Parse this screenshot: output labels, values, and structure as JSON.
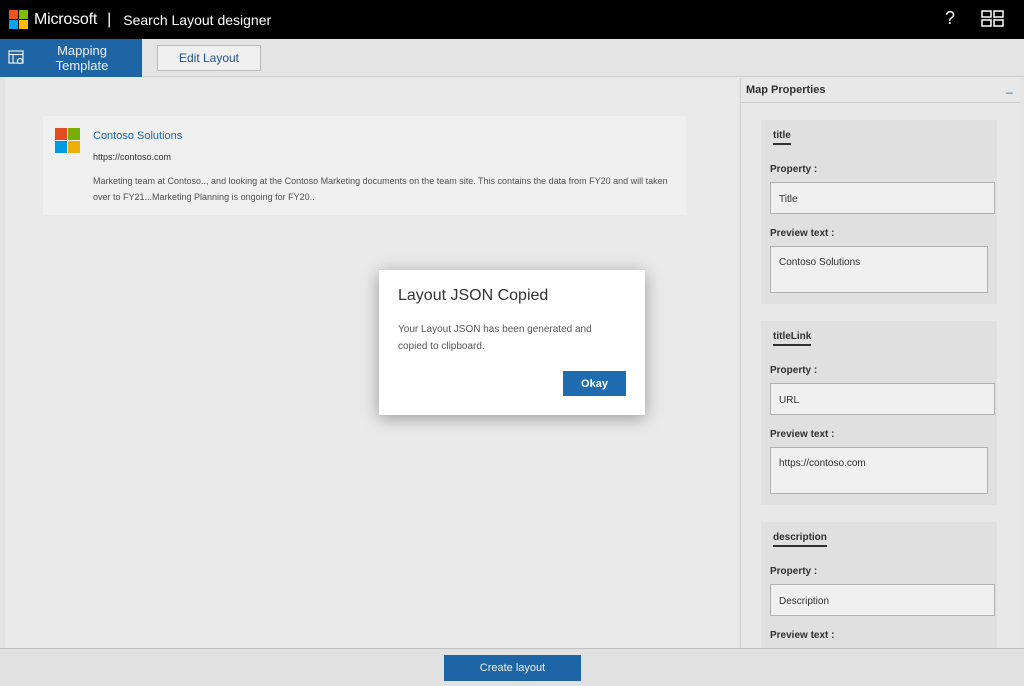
{
  "topbar": {
    "brand": "Microsoft",
    "separator": "|",
    "app_title": "Search Layout designer",
    "help_label": "?",
    "logo_colors": [
      "#f25022",
      "#7fba00",
      "#00a4ef",
      "#ffb900"
    ]
  },
  "ribbon": {
    "mapping_tab": "Mapping Template",
    "edit_tab": "Edit Layout"
  },
  "card": {
    "title": "Contoso Solutions",
    "url": "https://contoso.com",
    "description": "Marketing team at Contoso.., and looking at the Contoso Marketing documents on the team site. This contains the data from FY20 and will taken over to FY21...Marketing Planning is ongoing for FY20.."
  },
  "panel": {
    "heading": "Map Properties",
    "collapse_label": "_",
    "property_label": "Property :",
    "preview_label": "Preview text :",
    "properties": [
      {
        "name": "title",
        "property": "Title",
        "preview": "Contoso Solutions"
      },
      {
        "name": "titleLink",
        "property": "URL",
        "preview": "https://contoso.com"
      },
      {
        "name": "description",
        "property": "Description",
        "preview": ""
      }
    ]
  },
  "bottom": {
    "create_label": "Create layout"
  },
  "dialog": {
    "title": "Layout JSON Copied",
    "body": "Your Layout JSON has been generated and copied to clipboard.",
    "okay_label": "Okay"
  },
  "colors": {
    "accent": "#1f6cb0",
    "topbar": "#000000"
  }
}
